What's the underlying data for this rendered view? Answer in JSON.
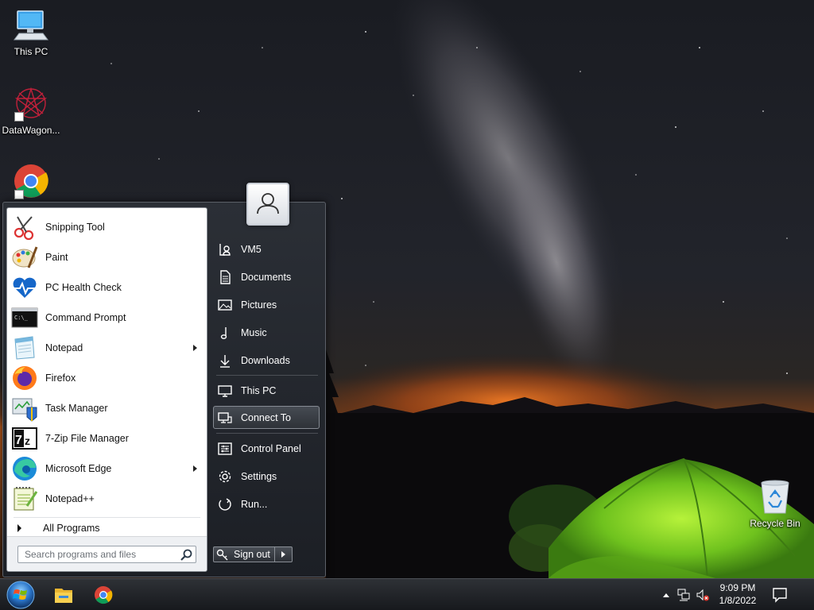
{
  "desktop": {
    "icons": [
      {
        "label": "This PC",
        "icon": "computer-icon"
      },
      {
        "label": "DataWagon...",
        "icon": "datawagon-icon"
      },
      {
        "label": "",
        "icon": "chrome-icon"
      },
      {
        "label": "Recycle Bin",
        "icon": "recycle-bin-icon"
      }
    ]
  },
  "start_menu": {
    "programs": [
      {
        "label": "Snipping Tool",
        "icon": "snipping-tool-icon",
        "submenu": false
      },
      {
        "label": "Paint",
        "icon": "paint-icon",
        "submenu": false
      },
      {
        "label": "PC Health Check",
        "icon": "pc-health-check-icon",
        "submenu": false
      },
      {
        "label": "Command Prompt",
        "icon": "command-prompt-icon",
        "submenu": false
      },
      {
        "label": "Notepad",
        "icon": "notepad-icon",
        "submenu": true
      },
      {
        "label": "Firefox",
        "icon": "firefox-icon",
        "submenu": false
      },
      {
        "label": "Task Manager",
        "icon": "task-manager-icon",
        "submenu": false
      },
      {
        "label": "7-Zip File Manager",
        "icon": "seven-zip-icon",
        "submenu": false
      },
      {
        "label": "Microsoft Edge",
        "icon": "edge-icon",
        "submenu": true
      },
      {
        "label": "Notepad++",
        "icon": "notepad-plus-plus-icon",
        "submenu": false
      }
    ],
    "all_programs_label": "All Programs",
    "search_placeholder": "Search programs and files",
    "right_items": [
      {
        "label": "VM5",
        "icon": "user-folder-icon"
      },
      {
        "label": "Documents",
        "icon": "documents-icon"
      },
      {
        "label": "Pictures",
        "icon": "pictures-icon"
      },
      {
        "label": "Music",
        "icon": "music-icon"
      },
      {
        "label": "Downloads",
        "icon": "downloads-icon"
      },
      {
        "label": "This PC",
        "icon": "computer-icon"
      },
      {
        "label": "Connect To",
        "icon": "connect-to-icon",
        "highlighted": true
      },
      {
        "label": "Control Panel",
        "icon": "control-panel-icon"
      },
      {
        "label": "Settings",
        "icon": "settings-gear-icon"
      },
      {
        "label": "Run...",
        "icon": "run-icon"
      }
    ],
    "sign_out_label": "Sign out"
  },
  "taskbar": {
    "pinned": [
      {
        "name": "File Explorer",
        "icon": "file-explorer-icon"
      },
      {
        "name": "Google Chrome",
        "icon": "chrome-icon"
      }
    ],
    "clock": {
      "time": "9:09 PM",
      "date": "1/8/2022"
    }
  },
  "colors": {
    "menu_dark": "#1c1f25",
    "menu_light": "#ffffff",
    "taskbar": "#17191d",
    "tent_green": "#7ed321",
    "horizon_orange": "#e86a1a"
  }
}
